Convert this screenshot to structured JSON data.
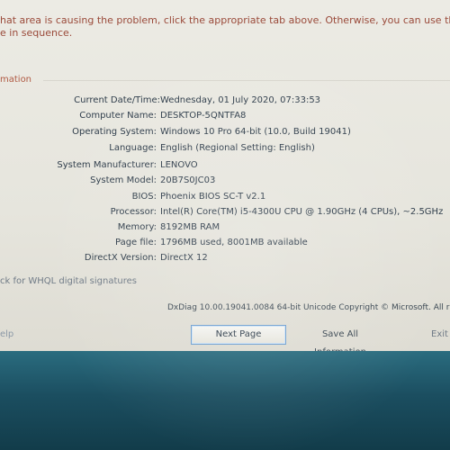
{
  "intro": {
    "line1": "hat area is causing the problem, click the appropriate tab above.  Otherwise, you can use the \"Next Page\" butto",
    "line2": "e in sequence."
  },
  "section": {
    "title": "mation"
  },
  "system_info": [
    {
      "label": "Current Date/Time:",
      "value": "Wednesday, 01 July 2020, 07:33:53"
    },
    {
      "label": "Computer Name:",
      "value": "DESKTOP-5QNTFA8"
    },
    {
      "label": "Operating System:",
      "value": "Windows 10 Pro 64-bit (10.0, Build 19041)"
    },
    {
      "label": "Language:",
      "value": "English (Regional Setting: English)"
    },
    {
      "label": "System Manufacturer:",
      "value": "LENOVO"
    },
    {
      "label": "System Model:",
      "value": "20B7S0JC03"
    },
    {
      "label": "BIOS:",
      "value": "Phoenix BIOS SC-T v2.1"
    },
    {
      "label": "Processor:",
      "value": "Intel(R) Core(TM) i5-4300U CPU @ 1.90GHz (4 CPUs), ~2.5GHz"
    },
    {
      "label": "Memory:",
      "value": "8192MB RAM"
    },
    {
      "label": "Page file:",
      "value": "1796MB used, 8001MB available"
    },
    {
      "label": "DirectX Version:",
      "value": "DirectX 12"
    }
  ],
  "whql_check": "ck for WHQL digital signatures",
  "dxdiag_version": "DxDiag 10.00.19041.0084 64-bit Unicode  Copyright © Microsoft. All rights r",
  "help_link": "elp",
  "buttons": {
    "next_page": "Next Page",
    "save_all": "Save All Information",
    "exit": "Exit"
  },
  "colors": {
    "window_bg": "#e8e7e0",
    "intro_text": "#9a4a3a",
    "label_text": "#2e3c4a",
    "taskbar": "#1f4f64"
  }
}
